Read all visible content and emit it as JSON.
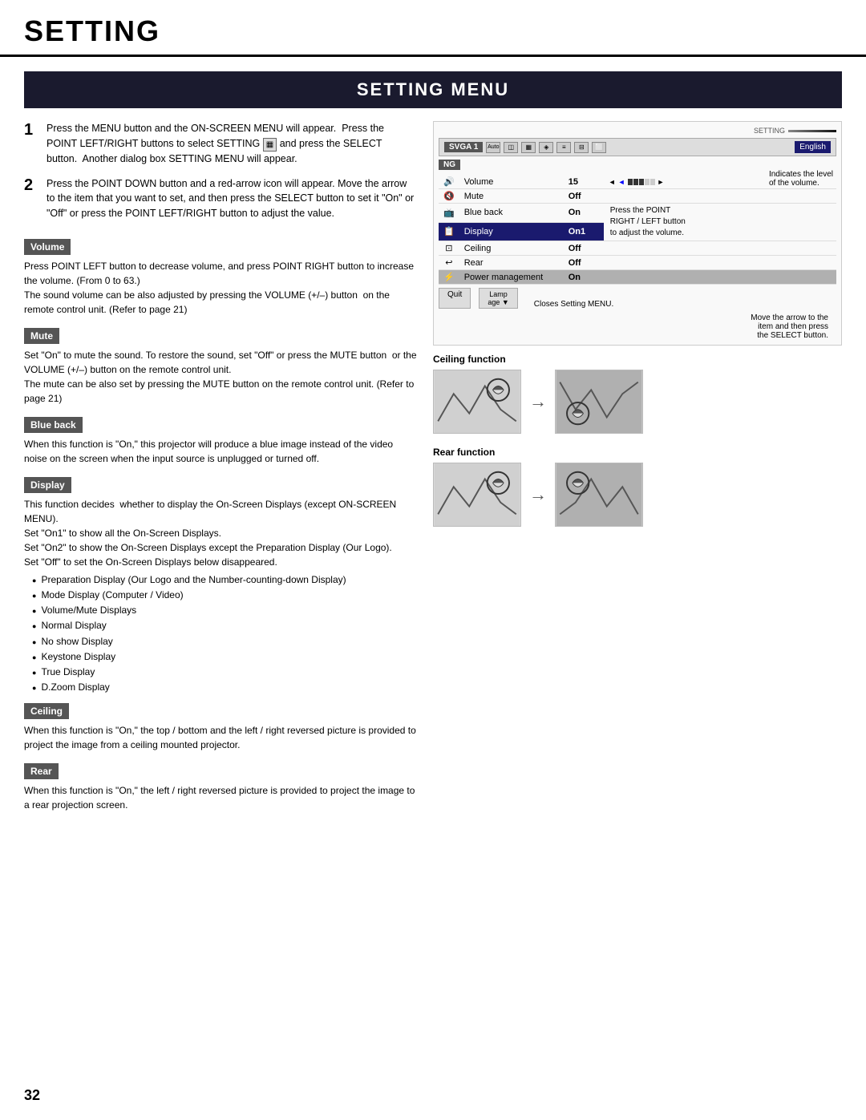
{
  "header": {
    "title": "SETTING"
  },
  "settingMenu": {
    "title": "SETTING MENU"
  },
  "steps": [
    {
      "number": "1",
      "text": "Press the MENU button and the ON-SCREEN MENU will appear.  Press the POINT LEFT/RIGHT buttons to select SETTING  and press the SELECT button.  Another dialog box SETTING MENU will appear."
    },
    {
      "number": "2",
      "text": "Press the POINT DOWN button and a red-arrow icon will appear.  Move the arrow to the item that you want to set, and then press the SELECT button to set it \"On\" or \"Off\" or press the POINT LEFT/RIGHT button to adjust the value."
    }
  ],
  "sections": [
    {
      "id": "volume",
      "label": "Volume",
      "body": "Press POINT LEFT button to decrease volume, and press POINT RIGHT button to increase the volume.  (From 0 to 63.)\nThe sound volume can be also adjusted by pressing the VOLUME (+/–) button  on the remote control unit.  (Refer to page 21)"
    },
    {
      "id": "mute",
      "label": "Mute",
      "body": "Set \"On\" to mute the sound.  To restore the sound, set \"Off\" or press the MUTE button  or the VOLUME (+/–) button on the remote control unit.\nThe mute can be also set by pressing the MUTE button on the remote control unit.  (Refer to page 21)"
    },
    {
      "id": "blueback",
      "label": "Blue back",
      "body": "When this function is \"On,\" this projector will produce a blue image instead of the video noise on the screen when the input source is unplugged or turned off."
    },
    {
      "id": "display",
      "label": "Display",
      "body": "This function decides  whether to display the On-Screen Displays (except ON-SCREEN MENU).\nSet \"On1\" to show all the On-Screen Displays.\nSet \"On2\" to show the On-Screen Displays except the Preparation Display (Our Logo).\nSet \"Off\" to set the On-Screen Displays below disappeared.",
      "bullets": [
        "Preparation Display (Our Logo and the Number-counting-down Display)",
        "Mode Display (Computer / Video)",
        "Volume/Mute Displays",
        "Normal Display",
        "No show Display",
        "Keystone Display",
        "True Display",
        "D.Zoom Display"
      ]
    },
    {
      "id": "ceiling",
      "label": "Ceiling",
      "body": "When this function is \"On,\" the top / bottom and the left / right reversed picture is provided to project the image from a ceiling mounted projector."
    },
    {
      "id": "rear",
      "label": "Rear",
      "body": "When this function is \"On,\" the left / right reversed picture is provided to project the image to a rear projection screen."
    }
  ],
  "uiDiagram": {
    "settingLabel": "SETTING",
    "svga": "SVGA 1",
    "english": "English",
    "ngLabel": "NG",
    "menuItems": [
      {
        "icon": "🔊",
        "name": "Volume",
        "value": "15",
        "hasBar": true
      },
      {
        "icon": "🔇",
        "name": "Mute",
        "value": "Off",
        "hasBar": false
      },
      {
        "icon": "📺",
        "name": "Blue back",
        "value": "On",
        "hasBar": false
      },
      {
        "icon": "📋",
        "name": "Display",
        "value": "On1",
        "hasBar": false,
        "highlight": true
      },
      {
        "icon": "⏹",
        "name": "Ceiling",
        "value": "Off",
        "hasBar": false
      },
      {
        "icon": "↩",
        "name": "Rear",
        "value": "Off",
        "hasBar": false
      },
      {
        "icon": "⚡",
        "name": "Power management",
        "value": "On",
        "hasBar": false,
        "power": true
      }
    ],
    "quitBtn": "Quit",
    "lampBtn": "Lamp age",
    "closes": "Closes Setting MENU.",
    "annotations": {
      "levelText": "Indicates the level of the volume.",
      "pressText": "Press the POINT RIGHT / LEFT button to adjust the volume.",
      "arrowText": "Move the arrow to the item and then press the SELECT button."
    }
  },
  "ceilingFunction": {
    "title": "Ceiling function"
  },
  "rearFunction": {
    "title": "Rear function"
  },
  "pageNumber": "32"
}
